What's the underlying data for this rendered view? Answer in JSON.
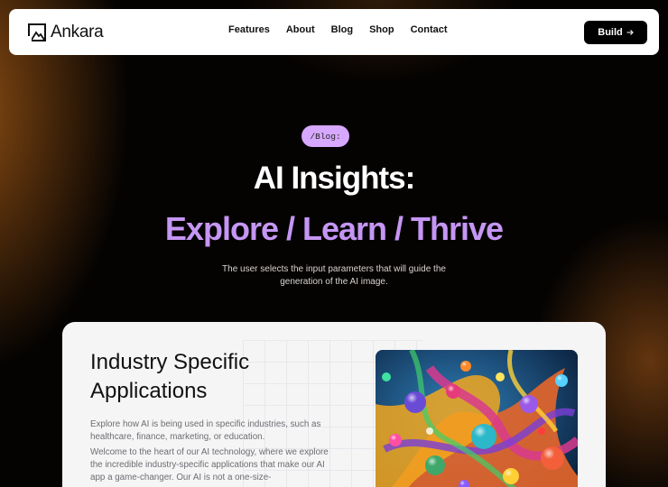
{
  "nav": {
    "brand": "Ankara",
    "links": [
      "Features",
      "About",
      "Blog",
      "Shop",
      "Contact"
    ],
    "cta_label": "Build",
    "cta_icon": "arrow-right-icon"
  },
  "hero": {
    "tag": "/Blog:",
    "title": "AI Insights:",
    "subtitle": "Explore / Learn / Thrive",
    "description": "The user selects the input parameters that will guide the generation of the AI image."
  },
  "card": {
    "title": "Industry Specific Applications",
    "paragraph1": "Explore how AI is being used in specific industries, such as healthcare, finance, marketing, or education.",
    "paragraph2": "Welcome to the heart of our AI technology, where we explore the incredible industry-specific applications that make our AI app a game-changer. Our AI is not a one-size-"
  },
  "colors": {
    "accent": "#c596f4",
    "tag_bg": "#d7a8ff",
    "glow": "#96521a"
  }
}
